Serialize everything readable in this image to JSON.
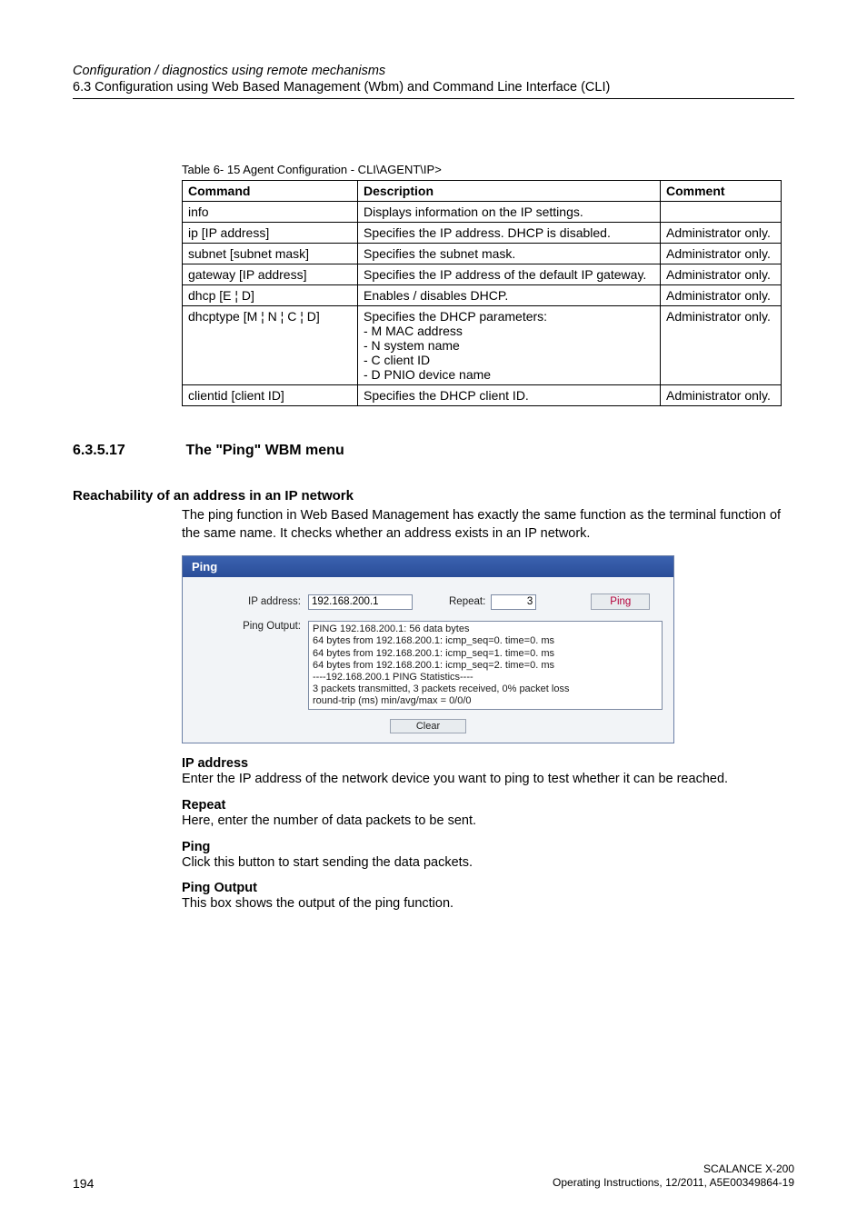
{
  "header": {
    "italic": "Configuration / diagnostics using remote mechanisms",
    "line": "6.3 Configuration using Web Based Management (Wbm) and Command Line Interface (CLI)"
  },
  "table_caption": "Table 6- 15    Agent Configuration - CLI\\AGENT\\IP>",
  "table": {
    "headers": {
      "cmd": "Command",
      "desc": "Description",
      "comment": "Comment"
    },
    "rows": [
      {
        "cmd": "info",
        "desc": "Displays information on the IP settings.",
        "comment": ""
      },
      {
        "cmd": "ip [IP address]",
        "desc": "Specifies the IP address. DHCP is disabled.",
        "comment": "Administrator only."
      },
      {
        "cmd": "subnet [subnet mask]",
        "desc": "Specifies the subnet mask.",
        "comment": "Administrator only."
      },
      {
        "cmd": "gateway [IP address]",
        "desc": "Specifies the IP address of the default IP gateway.",
        "comment": "Administrator only."
      },
      {
        "cmd": "dhcp [E ¦ D]",
        "desc": "Enables / disables DHCP.",
        "comment": "Administrator only."
      },
      {
        "cmd": "dhcptype [M ¦ N ¦ C ¦ D]",
        "desc": "Specifies the DHCP parameters:\n- M MAC address\n- N system name\n- C client ID\n- D PNIO device name",
        "comment": "Administrator only."
      },
      {
        "cmd": "clientid [client ID]",
        "desc": "Specifies the DHCP client ID.",
        "comment": "Administrator only."
      }
    ]
  },
  "section": {
    "num": "6.3.5.17",
    "title": "The \"Ping\" WBM menu"
  },
  "reach": {
    "heading": "Reachability of an address in an IP network",
    "text": "The ping function in Web Based Management has exactly the same function as the terminal function of the same name. It checks whether an address exists in an IP network."
  },
  "wbm": {
    "title": "Ping",
    "ip_label": "IP address:",
    "ip_value": "192.168.200.1",
    "repeat_label": "Repeat:",
    "repeat_value": "3",
    "ping_btn": "Ping",
    "output_label": "Ping Output:",
    "output_text": "PING 192.168.200.1: 56 data bytes\n64 bytes from 192.168.200.1: icmp_seq=0. time=0. ms\n64 bytes from 192.168.200.1: icmp_seq=1. time=0. ms\n64 bytes from 192.168.200.1: icmp_seq=2. time=0. ms\n----192.168.200.1 PING Statistics----\n3 packets transmitted, 3 packets received, 0% packet loss\nround-trip (ms) min/avg/max = 0/0/0",
    "clear_btn": "Clear"
  },
  "params": [
    {
      "title": "IP address",
      "text": "Enter the IP address of the network device you want to ping to test whether it can be reached."
    },
    {
      "title": "Repeat",
      "text": "Here, enter the number of data packets to be sent."
    },
    {
      "title": "Ping",
      "text": "Click this button to start sending the data packets."
    },
    {
      "title": "Ping Output",
      "text": "This box shows the output of the ping function."
    }
  ],
  "footer": {
    "page": "194",
    "prod": "SCALANCE X-200",
    "doc": "Operating Instructions, 12/2011, A5E00349864-19"
  }
}
